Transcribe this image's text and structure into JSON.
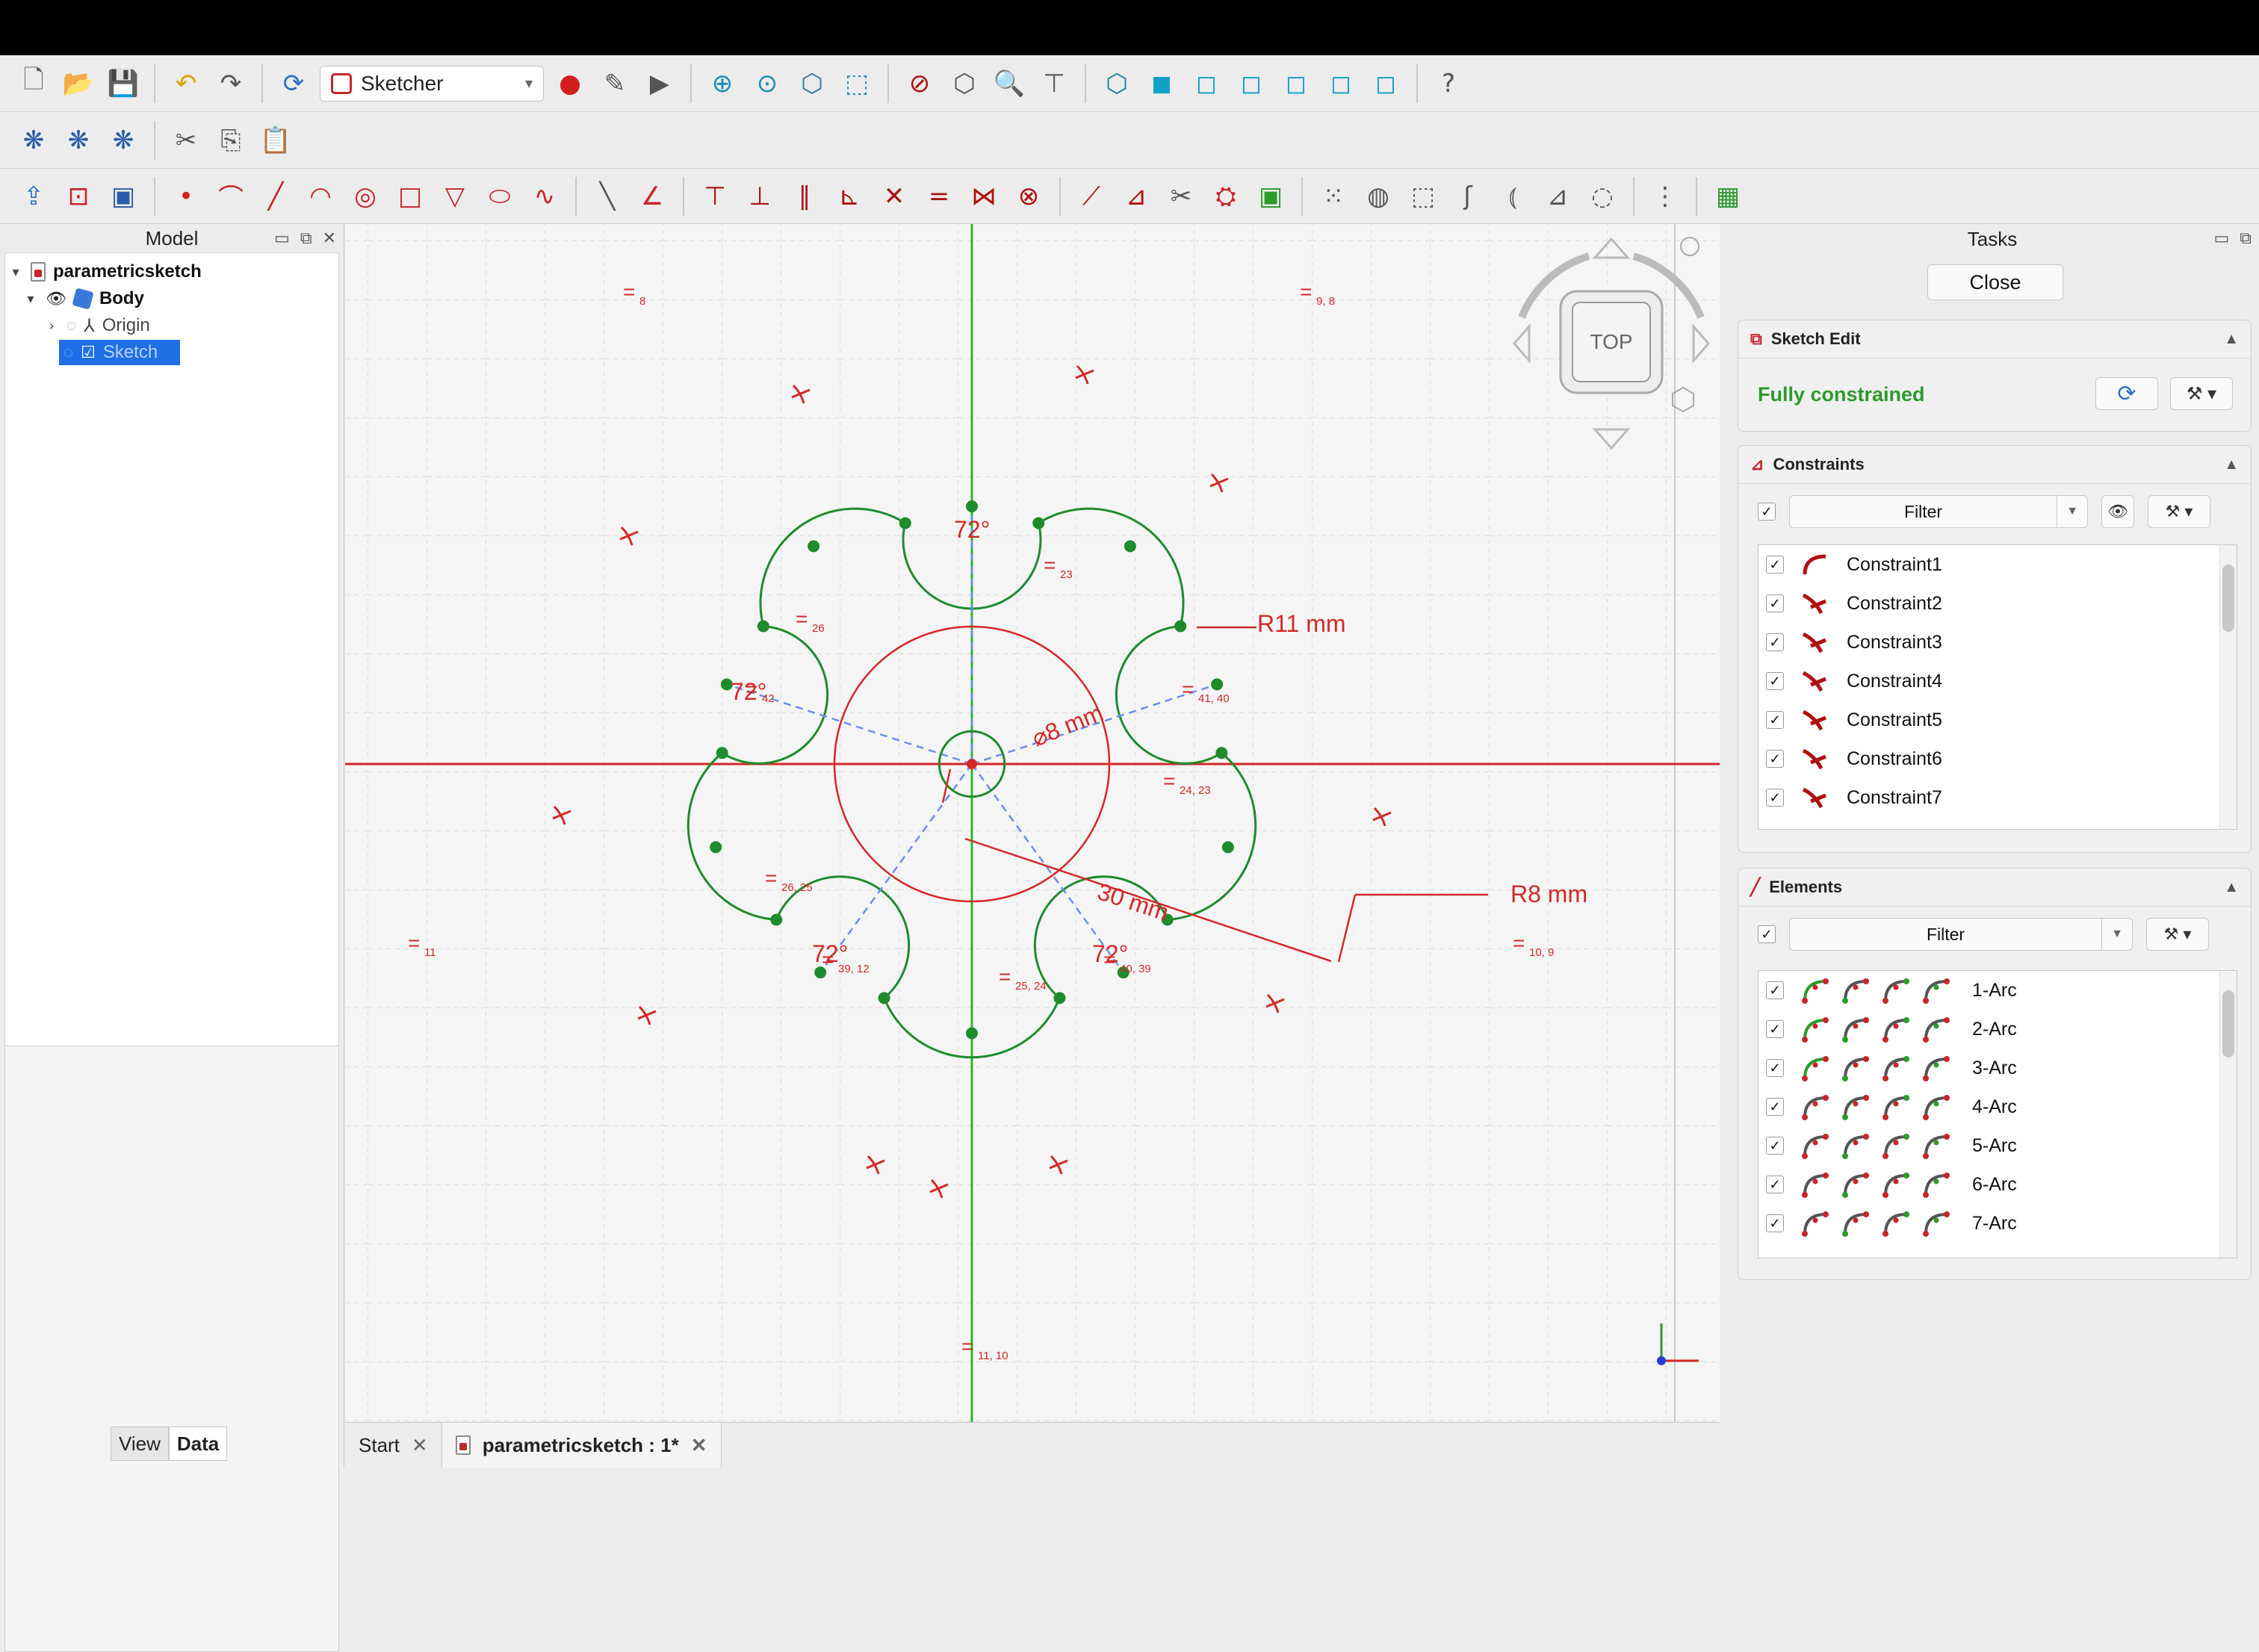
{
  "toolbar": {
    "workbench": "Sketcher"
  },
  "left_panel": {
    "title": "Model",
    "tree": [
      {
        "label": "parametricsketch",
        "bold": true
      },
      {
        "label": "Body",
        "bold": true
      },
      {
        "label": "Origin"
      },
      {
        "label": "Sketch",
        "selected": true
      }
    ],
    "view_tab": "View",
    "data_tab": "Data"
  },
  "doc_tabs": {
    "start": "Start",
    "active": "parametricsketch : 1*"
  },
  "nav_cube": {
    "face": "TOP"
  },
  "sketch": {
    "dims": {
      "r11": "R11 mm",
      "r8": "R8 mm",
      "dia": "⌀8 mm",
      "len": "30 mm",
      "ang_top": "72°",
      "ang_left": "72°",
      "ang_bl": "72°",
      "ang_br": "72°"
    },
    "constraint_tags": {
      "t8": "8",
      "t98": "9, 8",
      "t23": "23",
      "t26": "26",
      "t42": "42",
      "t4140": "41, 40",
      "t2423": "24, 23",
      "t2625": "26, 25",
      "t11": "11",
      "t3912": "39, 12",
      "t2524": "25, 24",
      "t4039": "40, 39",
      "t108": "10, 9",
      "t1110": "11, 10"
    },
    "colors": {
      "geometry": "#1e8c2c",
      "constraint": "#d42828",
      "construction": "#6c8ef0",
      "x_axis": "#d42828",
      "y_axis": "#2bb52b"
    }
  },
  "right_panel": {
    "title": "Tasks",
    "close_label": "Close",
    "sketch_edit": {
      "title": "Sketch Edit",
      "status": "Fully constrained"
    },
    "constraints": {
      "title": "Constraints",
      "filter_label": "Filter",
      "items": [
        "Constraint1",
        "Constraint2",
        "Constraint3",
        "Constraint4",
        "Constraint5",
        "Constraint6",
        "Constraint7"
      ]
    },
    "elements": {
      "title": "Elements",
      "filter_label": "Filter",
      "items": [
        "1-Arc",
        "2-Arc",
        "3-Arc",
        "4-Arc",
        "5-Arc",
        "6-Arc",
        "7-Arc"
      ]
    }
  }
}
